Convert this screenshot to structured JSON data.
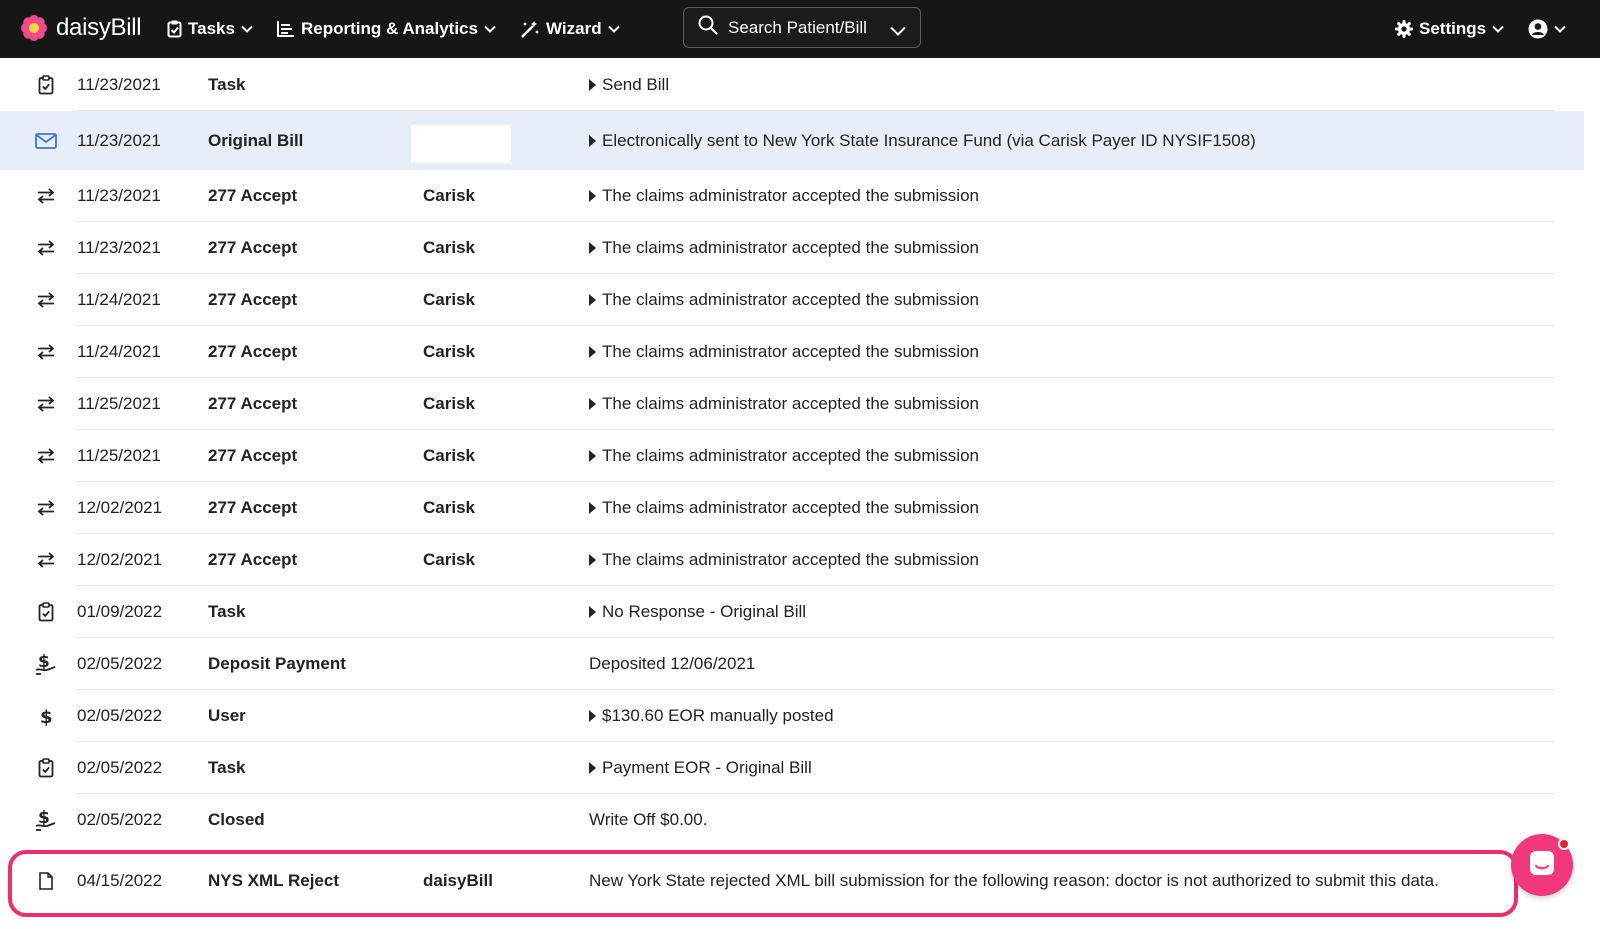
{
  "nav": {
    "brand": "daisyBill",
    "tasks": "Tasks",
    "reporting": "Reporting & Analytics",
    "wizard": "Wizard",
    "search_label": "Search Patient/Bill",
    "settings": "Settings"
  },
  "colors": {
    "topbar": "#161616",
    "highlight_row": "#e8eef9",
    "reject_outline": "#ee2e6b",
    "chat_button": "#f0397c",
    "mail_icon": "#3b78d6"
  },
  "rows": [
    {
      "icon": "clipboard-icon",
      "date": "11/23/2021",
      "type": "Task",
      "source": "",
      "caret": true,
      "description": "Send Bill"
    },
    {
      "icon": "mail-icon",
      "date": "11/23/2021",
      "type": "Original Bill",
      "source": "",
      "caret": true,
      "description": "Electronically sent to New York State Insurance Fund (via Carisk Payer ID NYSIF1508)"
    },
    {
      "icon": "exchange-icon",
      "date": "11/23/2021",
      "type": "277 Accept",
      "source": "Carisk",
      "caret": true,
      "description": "The claims administrator accepted the submission"
    },
    {
      "icon": "exchange-icon",
      "date": "11/23/2021",
      "type": "277 Accept",
      "source": "Carisk",
      "caret": true,
      "description": "The claims administrator accepted the submission"
    },
    {
      "icon": "exchange-icon",
      "date": "11/24/2021",
      "type": "277 Accept",
      "source": "Carisk",
      "caret": true,
      "description": "The claims administrator accepted the submission"
    },
    {
      "icon": "exchange-icon",
      "date": "11/24/2021",
      "type": "277 Accept",
      "source": "Carisk",
      "caret": true,
      "description": "The claims administrator accepted the submission"
    },
    {
      "icon": "exchange-icon",
      "date": "11/25/2021",
      "type": "277 Accept",
      "source": "Carisk",
      "caret": true,
      "description": "The claims administrator accepted the submission"
    },
    {
      "icon": "exchange-icon",
      "date": "11/25/2021",
      "type": "277 Accept",
      "source": "Carisk",
      "caret": true,
      "description": "The claims administrator accepted the submission"
    },
    {
      "icon": "exchange-icon",
      "date": "12/02/2021",
      "type": "277 Accept",
      "source": "Carisk",
      "caret": true,
      "description": "The claims administrator accepted the submission"
    },
    {
      "icon": "exchange-icon",
      "date": "12/02/2021",
      "type": "277 Accept",
      "source": "Carisk",
      "caret": true,
      "description": "The claims administrator accepted the submission"
    },
    {
      "icon": "clipboard-icon",
      "date": "01/09/2022",
      "type": "Task",
      "source": "",
      "caret": true,
      "description": "No Response - Original Bill"
    },
    {
      "icon": "hand-dollar-icon",
      "date": "02/05/2022",
      "type": "Deposit Payment",
      "source": "",
      "caret": false,
      "description": "Deposited 12/06/2021"
    },
    {
      "icon": "dollar-icon",
      "date": "02/05/2022",
      "type": "User",
      "source": "",
      "caret": true,
      "description": "$130.60 EOR manually posted"
    },
    {
      "icon": "clipboard-icon",
      "date": "02/05/2022",
      "type": "Task",
      "source": "",
      "caret": true,
      "description": "Payment EOR - Original Bill"
    },
    {
      "icon": "hand-dollar-icon",
      "date": "02/05/2022",
      "type": "Closed",
      "source": "",
      "caret": false,
      "description": "Write Off $0.00."
    },
    {
      "icon": "file-icon",
      "date": "04/15/2022",
      "type": "NYS XML Reject",
      "source": "daisyBill",
      "caret": false,
      "description": "New York State rejected XML bill submission for the following reason: doctor is not authorized to submit this data."
    }
  ]
}
